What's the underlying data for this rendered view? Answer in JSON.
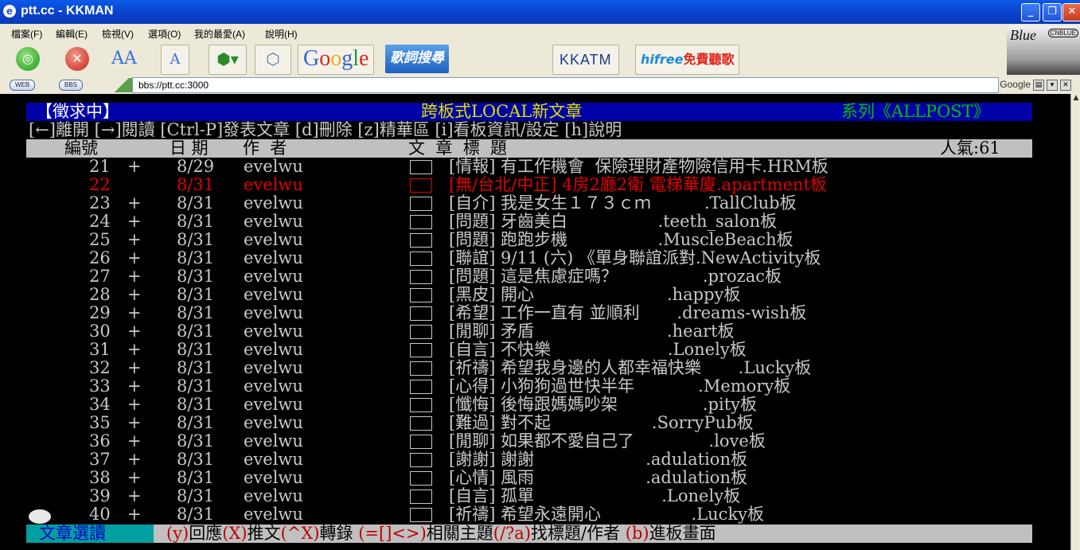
{
  "window": {
    "title": "ptt.cc - KKMAN",
    "minimize": "_",
    "restore": "❐",
    "close": "✕"
  },
  "menu": [
    "檔案(F)",
    "編輯(E)",
    "檢視(V)",
    "選項(O)",
    "我的最愛(A)",
    "說明(H)"
  ],
  "toolbar": {
    "font_big": "AA",
    "google": [
      "G",
      "o",
      "o",
      "g",
      "l",
      "e"
    ],
    "lyrics": "歌詞搜尋",
    "kkatm": "KKATM",
    "hifree": "hifree",
    "hifree_cn": "免費聽歌"
  },
  "banner": {
    "text": "Blue",
    "badge": "CNBLUE"
  },
  "address": {
    "web": "WEB",
    "bbs": "BBS",
    "url": "bbs://ptt.cc:3000",
    "google": "Google"
  },
  "terminal": {
    "header": {
      "left": "【徵求中】",
      "center": "跨板式LOCAL新文章",
      "right": "系列《ALLPOST》"
    },
    "commands": "[←]離開 [→]閱讀 [Ctrl-P]發表文章 [d]刪除 [z]精華區 [i]看板資訊/設定 [h]說明",
    "columns": {
      "num": "編號",
      "date": "日 期",
      "author": "作  者",
      "title": "文  章  標  題",
      "popularity": "人氣:61"
    },
    "articles": [
      {
        "num": "21",
        "mark": "+",
        "date": "8/29",
        "author": "evelwu",
        "title": "[情報] 有工作機會  保險理財產物險信用卡.HRM板",
        "hot": false
      },
      {
        "num": "22",
        "mark": "",
        "date": "8/31",
        "author": "evelwu",
        "title": "[無/台北/中正] 4房2廳2衛 電梯華廈.apartment板",
        "hot": true
      },
      {
        "num": "23",
        "mark": "+",
        "date": "8/31",
        "author": "evelwu",
        "title": "[自介] 我是女生１７３ｃｍ          .TallClub板",
        "hot": false
      },
      {
        "num": "24",
        "mark": "+",
        "date": "8/31",
        "author": "evelwu",
        "title": "[問題] 牙齒美白                 .teeth_salon板",
        "hot": false
      },
      {
        "num": "25",
        "mark": "+",
        "date": "8/31",
        "author": "evelwu",
        "title": "[問題] 跑跑步機                 .MuscleBeach板",
        "hot": false
      },
      {
        "num": "26",
        "mark": "+",
        "date": "8/31",
        "author": "evelwu",
        "title": "[聯誼] 9/11 (六) 《單身聯誼派對.NewActivity板",
        "hot": false
      },
      {
        "num": "27",
        "mark": "+",
        "date": "8/31",
        "author": "evelwu",
        "title": "[問題] 這是焦慮症嗎？                .prozac板",
        "hot": false
      },
      {
        "num": "28",
        "mark": "+",
        "date": "8/31",
        "author": "evelwu",
        "title": "[黑皮] 開心                         .happy板",
        "hot": false
      },
      {
        "num": "29",
        "mark": "+",
        "date": "8/31",
        "author": "evelwu",
        "title": "[希望] 工作一直有 並順利       .dreams-wish板",
        "hot": false
      },
      {
        "num": "30",
        "mark": "+",
        "date": "8/31",
        "author": "evelwu",
        "title": "[閒聊] 矛盾                         .heart板",
        "hot": false
      },
      {
        "num": "31",
        "mark": "+",
        "date": "8/31",
        "author": "evelwu",
        "title": "[自言] 不快樂                      .Lonely板",
        "hot": false
      },
      {
        "num": "32",
        "mark": "+",
        "date": "8/31",
        "author": "evelwu",
        "title": "[祈禱] 希望我身邊的人都幸福快樂       .Lucky板",
        "hot": false
      },
      {
        "num": "33",
        "mark": "+",
        "date": "8/31",
        "author": "evelwu",
        "title": "[心得] 小狗狗過世快半年            .Memory板",
        "hot": false
      },
      {
        "num": "34",
        "mark": "+",
        "date": "8/31",
        "author": "evelwu",
        "title": "[懺悔] 後悔跟媽媽吵架                .pity板",
        "hot": false
      },
      {
        "num": "35",
        "mark": "+",
        "date": "8/31",
        "author": "evelwu",
        "title": "[難過] 對不起                   .SorryPub板",
        "hot": false
      },
      {
        "num": "36",
        "mark": "+",
        "date": "8/31",
        "author": "evelwu",
        "title": "[閒聊] 如果都不愛自己了              .love板",
        "hot": false
      },
      {
        "num": "37",
        "mark": "+",
        "date": "8/31",
        "author": "evelwu",
        "title": "[謝謝] 謝謝                     .adulation板",
        "hot": false
      },
      {
        "num": "38",
        "mark": "+",
        "date": "8/31",
        "author": "evelwu",
        "title": "[心情] 風雨                     .adulation板",
        "hot": false
      },
      {
        "num": "39",
        "mark": "+",
        "date": "8/31",
        "author": "evelwu",
        "title": "[自言] 孤單                        .Lonely板",
        "hot": false
      },
      {
        "num": "40",
        "mark": "+",
        "date": "8/31",
        "author": "evelwu",
        "title": "[祈禱] 希望永遠開心                 .Lucky板",
        "hot": false
      }
    ],
    "footer": {
      "mode": "文章選讀",
      "parts": [
        {
          "t": "(y)",
          "red": true
        },
        {
          "t": "回應",
          "red": false
        },
        {
          "t": "(X)",
          "red": true
        },
        {
          "t": "推文",
          "red": false
        },
        {
          "t": "(^X)",
          "red": true
        },
        {
          "t": "轉錄 ",
          "red": false
        },
        {
          "t": "(=[]<>)",
          "red": true
        },
        {
          "t": "相關主題",
          "red": false
        },
        {
          "t": "(/?a)",
          "red": true
        },
        {
          "t": "找標題/作者 ",
          "red": false
        },
        {
          "t": "(b)",
          "red": true
        },
        {
          "t": "進板畫面",
          "red": false
        }
      ]
    }
  },
  "colors": {
    "header_bg": "#0000a8",
    "header_right": "#00c000",
    "hot": "#e00000",
    "mode_bg": "#00a0a0"
  }
}
